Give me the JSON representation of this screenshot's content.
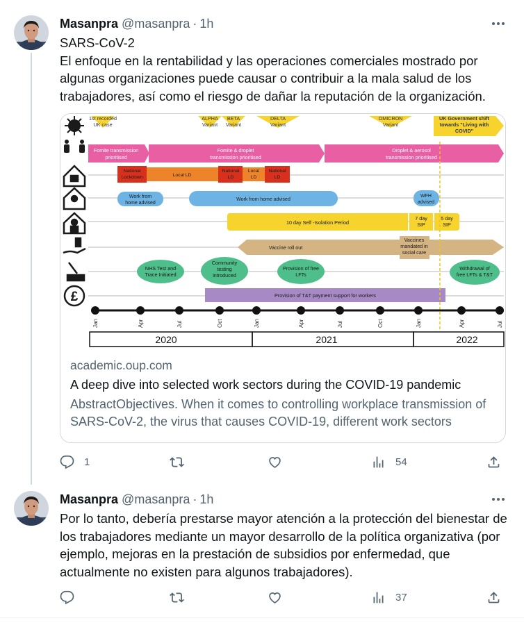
{
  "thread": [
    {
      "author": {
        "name": "Masanpra",
        "handle": "@masanpra",
        "time": "1h"
      },
      "text": [
        "SARS-CoV-2",
        "El enfoque en la rentabilidad y las operaciones comerciales mostrado por algunas organizaciones puede causar o contribuir a la mala salud de los trabajadores, así como el riesgo de dañar la reputación de la organización."
      ],
      "card": {
        "domain": "academic.oup.com",
        "title": "A deep dive into selected work sectors during the COVID-19 pandemic",
        "description": "AbstractObjectives. When it comes to controlling workplace transmission of SARS-CoV-2, the virus that causes COVID-19, different work sectors"
      },
      "stats": {
        "replies": "1",
        "retweets": "",
        "likes": "",
        "views": "54"
      }
    },
    {
      "author": {
        "name": "Masanpra",
        "handle": "@masanpra",
        "time": "1h"
      },
      "text": [
        "Por lo tanto, debería prestarse mayor atención a la protección del bienestar de los trabajadores mediante un mayor desarrollo de la política organizativa (por ejemplo, mejoras en la prestación de subsidios por enfermedad, que actualmente no existen para algunos trabajadores)."
      ],
      "stats": {
        "replies": "",
        "retweets": "",
        "likes": "",
        "views": "37"
      }
    }
  ],
  "timeline": {
    "milestones": [
      "1st recorded UK case",
      "ALPHA Variant",
      "BETA Variant",
      "DELTA Variant",
      "OMICRON Variant",
      "UK Government shift towards \"Living with COVID\""
    ],
    "transmission": [
      "Fomite transmission prioritised",
      "Fomite & droplet transmission prioritised",
      "Droplet & aerosol transmission prioritised"
    ],
    "lockdowns": [
      "National Lockdown",
      "Local LD",
      "National LD",
      "Local LD",
      "National LD"
    ],
    "wfh": [
      "Work from home advised",
      "Work from home advised",
      "WFH advised"
    ],
    "isolation": [
      "10 day Self -Isolation Period",
      "7 day SIP",
      "5 day SIP"
    ],
    "vaccine": [
      "Vaccine roll out",
      "Vaccines mandated in social care"
    ],
    "testing": [
      "NHS Test and Trace Initiated",
      "Community testing introduced",
      "Provision of free LFTs",
      "Withdrawal of free LFTs & T&T"
    ],
    "payment": [
      "Provision of T&T payment support for workers"
    ],
    "months": [
      "Jan",
      "Apr",
      "Jul",
      "Oct",
      "Jan",
      "Apr",
      "Jul",
      "Oct",
      "Jan",
      "Apr",
      "Jul"
    ],
    "years": [
      "2020",
      "2021",
      "2022"
    ],
    "colors": {
      "yellow": "#f6d32d",
      "pink": "#e95fa4",
      "red": "#d7311d",
      "orange": "#ee8429",
      "blue": "#6db4e4",
      "tan": "#d4b483",
      "green": "#4ebf8b",
      "purple": "#a689c5",
      "dashed": "#f2c319"
    }
  }
}
